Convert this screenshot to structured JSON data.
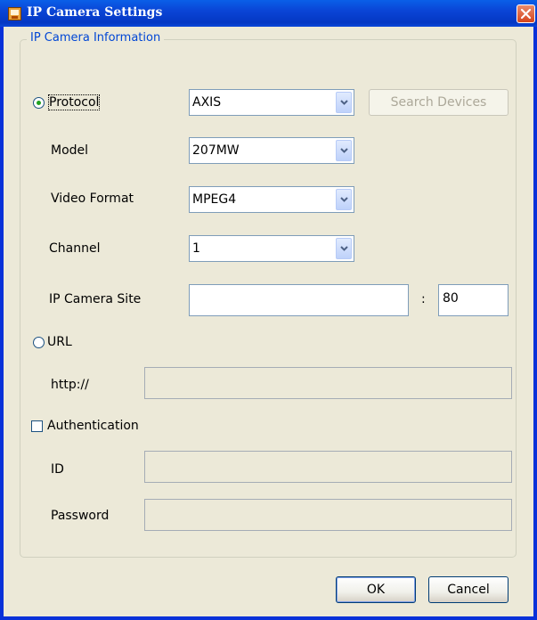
{
  "window": {
    "title": "IP Camera Settings"
  },
  "group": {
    "legend": "IP Camera Information"
  },
  "protocol": {
    "label": "Protocol",
    "value": "AXIS",
    "search_button": "Search Devices"
  },
  "model": {
    "label": "Model",
    "value": "207MW"
  },
  "video_format": {
    "label": "Video Format",
    "value": "MPEG4"
  },
  "channel": {
    "label": "Channel",
    "value": "1"
  },
  "site": {
    "label": "IP Camera Site",
    "host": "",
    "separator": ":",
    "port": "80"
  },
  "url": {
    "label": "URL",
    "prefix": "http://",
    "value": ""
  },
  "auth": {
    "label": "Authentication",
    "id_label": "ID",
    "id_value": "",
    "password_label": "Password",
    "password_value": ""
  },
  "footer": {
    "ok": "OK",
    "cancel": "Cancel"
  },
  "colors": {
    "title_bar": "#0a46d6",
    "client": "#ece9d8",
    "legend": "#0046d5"
  }
}
